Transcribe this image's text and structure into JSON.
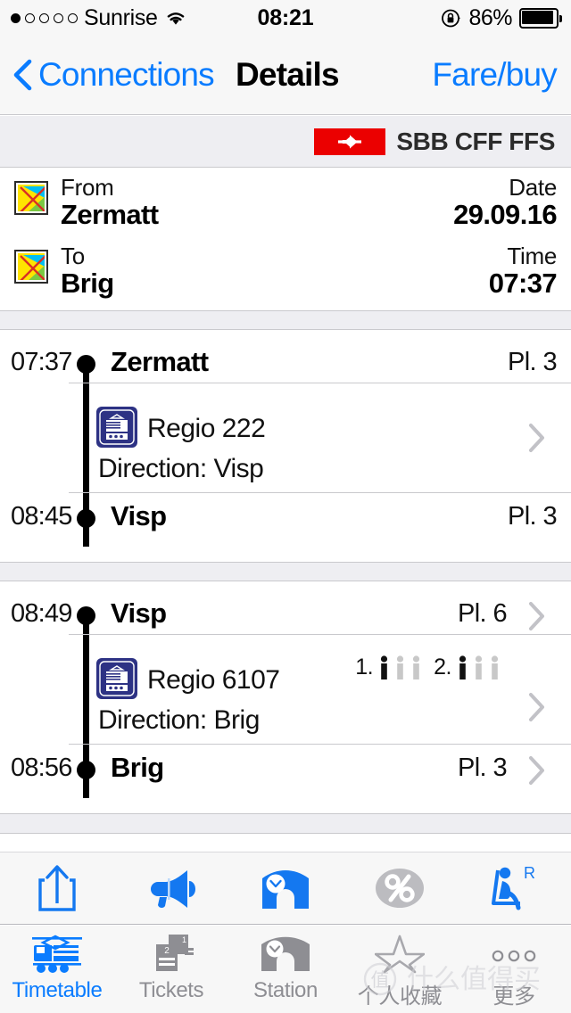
{
  "status_bar": {
    "carrier": "Sunrise",
    "signal_dots_total": 5,
    "signal_dots_filled": 1,
    "wifi_icon": "wifi-icon",
    "time": "08:21",
    "rotation_lock_icon": "rotation-lock-icon",
    "battery_percent": "86%",
    "battery_icon": "battery-full-icon"
  },
  "nav": {
    "back_icon": "chevron-left-icon",
    "back_label": "Connections",
    "title": "Details",
    "right_action": "Fare/buy"
  },
  "brand": {
    "logo_icon": "sbb-cross-arrows-icon",
    "text": "SBB CFF FFS",
    "logo_color": "#eb0000"
  },
  "summary": {
    "from": {
      "icon": "broken-image-icon",
      "label": "From",
      "value": "Zermatt"
    },
    "to": {
      "icon": "broken-image-icon",
      "label": "To",
      "value": "Brig"
    },
    "date": {
      "label": "Date",
      "value": "29.09.16"
    },
    "time": {
      "label": "Time",
      "value": "07:37"
    }
  },
  "legs": [
    {
      "departure": {
        "time": "07:37",
        "station": "Zermatt",
        "platform": "Pl. 3",
        "chevron": false
      },
      "service": {
        "icon": "train-icon",
        "line": "Regio 222",
        "direction": "Direction: Visp",
        "chevron": true,
        "occupancy": []
      },
      "arrival": {
        "time": "08:45",
        "station": "Visp",
        "platform": "Pl. 3",
        "chevron": false
      }
    },
    {
      "departure": {
        "time": "08:49",
        "station": "Visp",
        "platform": "Pl. 6",
        "chevron": true
      },
      "service": {
        "icon": "train-icon",
        "line": "Regio 6107",
        "direction": "Direction: Brig",
        "chevron": true,
        "occupancy": [
          {
            "class_label": "1.",
            "figures_filled": 1,
            "figures_total": 3
          },
          {
            "class_label": "2.",
            "figures_filled": 1,
            "figures_total": 3
          }
        ]
      },
      "arrival": {
        "time": "08:56",
        "station": "Brig",
        "platform": "Pl. 3",
        "chevron": true
      }
    }
  ],
  "action_toolbar": {
    "accent_color": "#1478f0",
    "disabled_color": "#bcbcc0",
    "items": [
      {
        "icon": "share-icon",
        "enabled": true
      },
      {
        "icon": "megaphone-icon",
        "enabled": true
      },
      {
        "icon": "station-clock-icon",
        "enabled": true
      },
      {
        "icon": "percent-icon",
        "enabled": false
      },
      {
        "icon": "seat-reservation-icon",
        "enabled": true
      }
    ]
  },
  "tab_bar": {
    "active_color": "#0a7cff",
    "inactive_color": "#8e8e93",
    "tabs": [
      {
        "icon": "train-front-icon",
        "label": "Timetable",
        "active": true
      },
      {
        "icon": "tickets-icon",
        "label": "Tickets",
        "active": false
      },
      {
        "icon": "station-clock-icon",
        "label": "Station",
        "active": false
      },
      {
        "icon": "star-icon",
        "label": "个人收藏",
        "active": false
      },
      {
        "icon": "more-dots-icon",
        "label": "更多",
        "active": false
      }
    ]
  },
  "watermark": {
    "text": "值 什么值得买"
  }
}
